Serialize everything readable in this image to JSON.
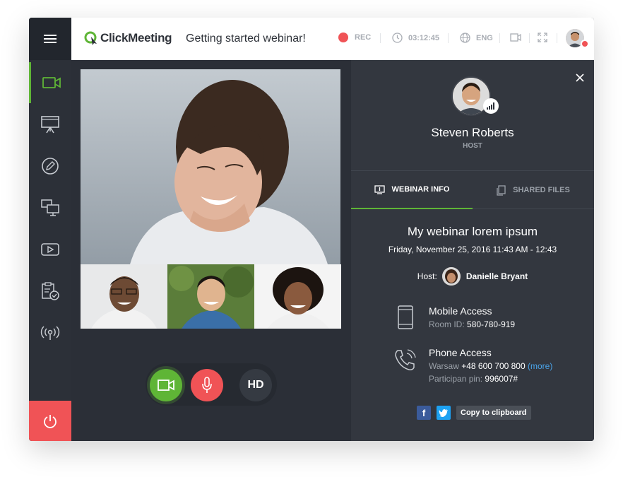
{
  "header": {
    "brand": "ClickMeeting",
    "webinar_title": "Getting started webinar!",
    "rec_label": "REC",
    "timer": "03:12:45",
    "language": "ENG"
  },
  "sidebar": {
    "items": [
      {
        "icon": "video-camera-icon"
      },
      {
        "icon": "presentation-icon"
      },
      {
        "icon": "pencil-icon"
      },
      {
        "icon": "screen-share-icon"
      },
      {
        "icon": "youtube-play-icon"
      },
      {
        "icon": "clipboard-check-icon"
      },
      {
        "icon": "broadcast-icon"
      }
    ]
  },
  "controls": {
    "hd_label": "HD"
  },
  "panel": {
    "host_name": "Steven Roberts",
    "host_role": "HOST",
    "tabs": [
      {
        "label": "WEBINAR INFO",
        "active": true
      },
      {
        "label": "SHARED FILES",
        "active": false
      }
    ],
    "webinar": {
      "title": "My webinar lorem ipsum",
      "datetime": "Friday, November 25, 2016  11:43 AM - 12:43",
      "host_label": "Host:",
      "host_name": "Danielle Bryant"
    },
    "mobile": {
      "title": "Mobile Access",
      "room_label": "Room ID:",
      "room_id": "580-780-919"
    },
    "phone": {
      "title": "Phone Access",
      "city": "Warsaw",
      "number": "+48 600 700 800",
      "more": "(more)",
      "pin_label": "Participan pin:",
      "pin": "996007#"
    },
    "share": {
      "facebook": "f",
      "copy_label": "Copy to clipboard"
    }
  },
  "colors": {
    "accent_green": "#5fb536",
    "accent_red": "#f05356",
    "link_blue": "#4aa3e8"
  }
}
